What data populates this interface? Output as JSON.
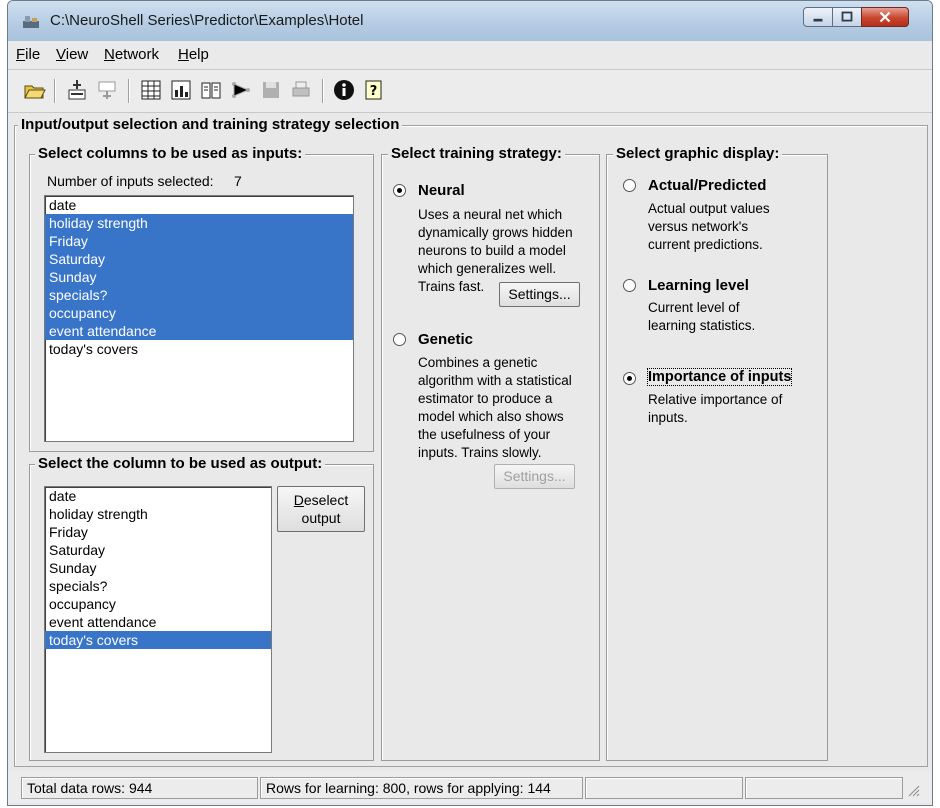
{
  "window": {
    "title": "C:\\NeuroShell Series\\Predictor\\Examples\\Hotel"
  },
  "menu": {
    "file": {
      "accel": "F",
      "rest": "ile"
    },
    "view": {
      "accel": "V",
      "rest": "iew"
    },
    "network": {
      "accel": "N",
      "rest": "etwork"
    },
    "help": {
      "accel": "H",
      "rest": "elp"
    }
  },
  "toolbar_icons": [
    "open-folder-icon",
    "add-icon",
    "remove-icon",
    "grid-icon",
    "chart-icon",
    "book-icon",
    "network-icon",
    "save-icon",
    "print-icon",
    "info-icon",
    "help-icon"
  ],
  "main_group": {
    "title": "Input/output selection and training strategy selection"
  },
  "inputs": {
    "title": "Select columns to be used as inputs:",
    "count_label": "Number of inputs selected:",
    "count": "7",
    "items": [
      {
        "label": "date",
        "selected": false
      },
      {
        "label": "holiday strength",
        "selected": true
      },
      {
        "label": "Friday",
        "selected": true
      },
      {
        "label": "Saturday",
        "selected": true
      },
      {
        "label": "Sunday",
        "selected": true
      },
      {
        "label": "specials?",
        "selected": true
      },
      {
        "label": "occupancy",
        "selected": true
      },
      {
        "label": "event attendance",
        "selected": true
      },
      {
        "label": "today's covers",
        "selected": false
      }
    ]
  },
  "output": {
    "title": "Select the column to be used as output:",
    "deselect_accel": "D",
    "deselect_line1_rest": "eselect",
    "deselect_line2": "output",
    "items": [
      {
        "label": "date",
        "selected": false
      },
      {
        "label": "holiday strength",
        "selected": false
      },
      {
        "label": "Friday",
        "selected": false
      },
      {
        "label": "Saturday",
        "selected": false
      },
      {
        "label": "Sunday",
        "selected": false
      },
      {
        "label": "specials?",
        "selected": false
      },
      {
        "label": "occupancy",
        "selected": false
      },
      {
        "label": "event attendance",
        "selected": false
      },
      {
        "label": "today's covers",
        "selected": true
      }
    ]
  },
  "training": {
    "title": "Select training strategy:",
    "neural": {
      "label": "Neural",
      "checked": true,
      "desc": [
        "Uses a neural net which",
        "dynamically grows hidden",
        "neurons to build a model",
        "which generalizes well.",
        "Trains fast."
      ],
      "settings": "Settings..."
    },
    "genetic": {
      "label": "Genetic",
      "checked": false,
      "desc": [
        "Combines a genetic",
        "algorithm with a statistical",
        "estimator to produce a",
        "model which also shows",
        "the usefulness of your",
        "inputs. Trains slowly."
      ],
      "settings": "Settings..."
    }
  },
  "graphic": {
    "title": "Select graphic display:",
    "actual": {
      "label": "Actual/Predicted",
      "checked": false,
      "desc": [
        "Actual output values",
        "versus network's",
        "current predictions."
      ]
    },
    "learning": {
      "label": "Learning level",
      "checked": false,
      "desc": [
        "Current level of",
        "learning statistics."
      ]
    },
    "importance": {
      "label": "Importance of inputs",
      "checked": true,
      "desc": [
        "Relative importance of",
        "inputs."
      ]
    }
  },
  "status": {
    "total": "Total data rows: 944",
    "rows": "Rows for learning: 800, rows for applying: 144"
  }
}
